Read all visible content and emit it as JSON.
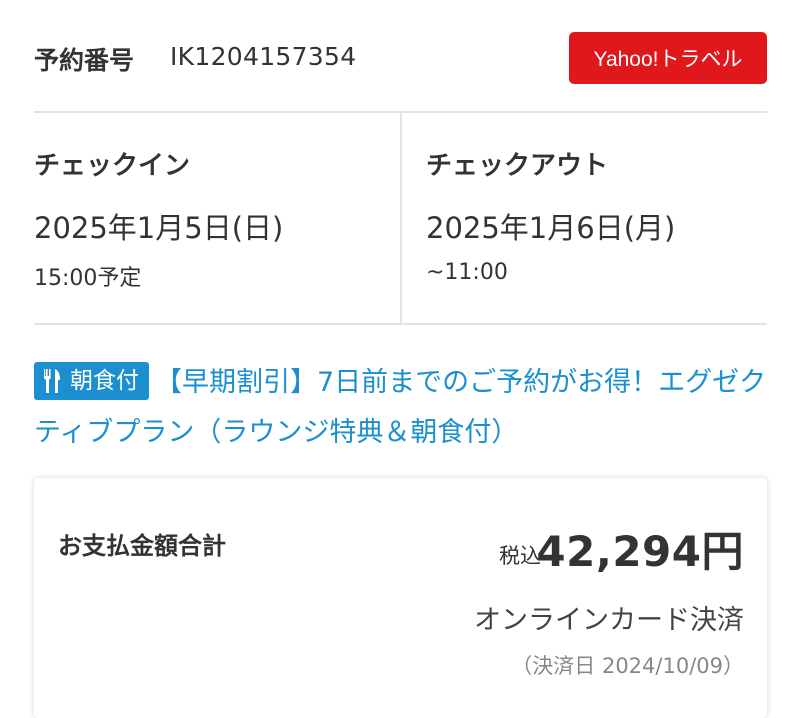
{
  "reservation": {
    "label": "予約番号",
    "number": "IK1204157354",
    "provider_badge": "Yahoo!トラベル",
    "provider_color": "#e0171b"
  },
  "checkin": {
    "title": "チェックイン",
    "date": "2025年1月5日(日)",
    "time": "15:00予定"
  },
  "checkout": {
    "title": "チェックアウト",
    "date": "2025年1月6日(月)",
    "time": "~11:00"
  },
  "plan": {
    "meal_badge": "朝食付",
    "meal_icon": "fork-knife-icon",
    "name": "【早期割引】7日前までのご予約がお得！エグゼクティブプラン（ラウンジ特典＆朝食付）",
    "link_color": "#1b8fd0"
  },
  "payment": {
    "total_label": "お支払金額合計",
    "tax_label": "税込",
    "amount": "42,294円",
    "method": "オンラインカード決済",
    "date": "（決済日 2024/10/09）"
  }
}
